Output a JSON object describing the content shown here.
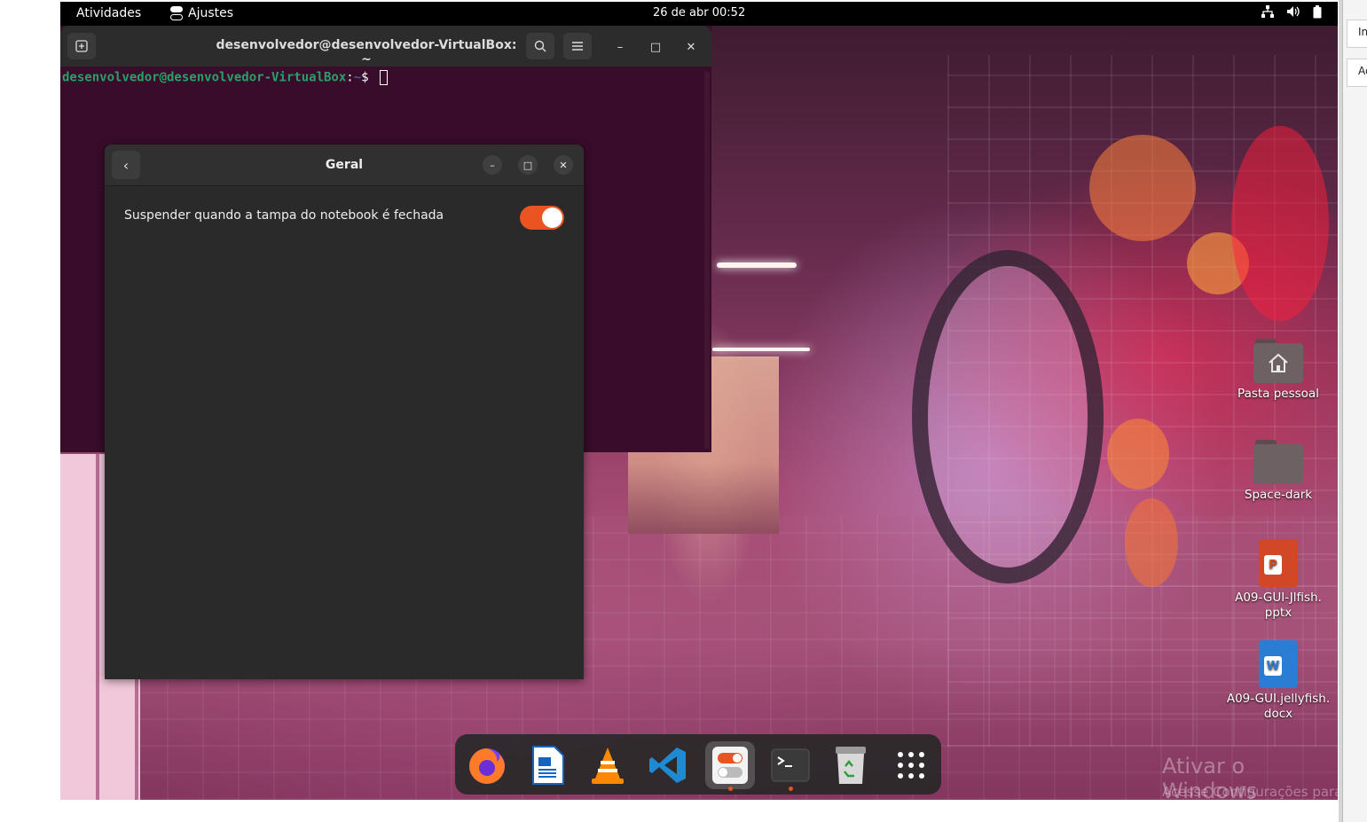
{
  "topbar": {
    "activities": "Atividades",
    "app_name": "Ajustes",
    "clock": "26 de abr  00:52",
    "tray_icons": [
      "network-icon",
      "volume-icon",
      "battery-icon"
    ]
  },
  "terminal": {
    "title": "desenvolvedor@desenvolvedor-VirtualBox: ~",
    "prompt_user": "desenvolvedor@desenvolvedor-VirtualBox",
    "prompt_sep": ":",
    "prompt_path": "~",
    "prompt_symbol": "$ ",
    "buttons": {
      "new_tab": "new-tab-icon",
      "search": "search-icon",
      "menu": "hamburger-menu-icon",
      "minimize": "–",
      "maximize": "□",
      "close": "✕"
    }
  },
  "dialog": {
    "title": "Geral",
    "back": "‹",
    "setting_label": "Suspender quando a tampa do notebook é fechada",
    "setting_enabled": true,
    "minimize": "–",
    "maximize": "□",
    "close": "✕",
    "accent": "#e95420"
  },
  "desktop_icons": [
    {
      "label": "Pasta pessoal",
      "type": "home-folder"
    },
    {
      "label": "Space-dark",
      "type": "folder"
    },
    {
      "label": "A09-GUI-Jlfish.\npptx",
      "type": "pptx"
    },
    {
      "label": "A09-GUI.jellyfish.\ndocx",
      "type": "docx"
    }
  ],
  "dock": {
    "apps": [
      "Firefox",
      "LibreOffice Writer",
      "VLC",
      "Visual Studio Code",
      "Ajustes",
      "Terminal",
      "Lixeira",
      "Mostrar aplicativos"
    ],
    "active": "Ajustes",
    "running": [
      "Ajustes",
      "Terminal"
    ]
  },
  "watermark": {
    "line1": "Ativar o Windows",
    "line2": "Acesse Configurações para at"
  },
  "host": {
    "box1": "In",
    "box2": "Ac"
  }
}
